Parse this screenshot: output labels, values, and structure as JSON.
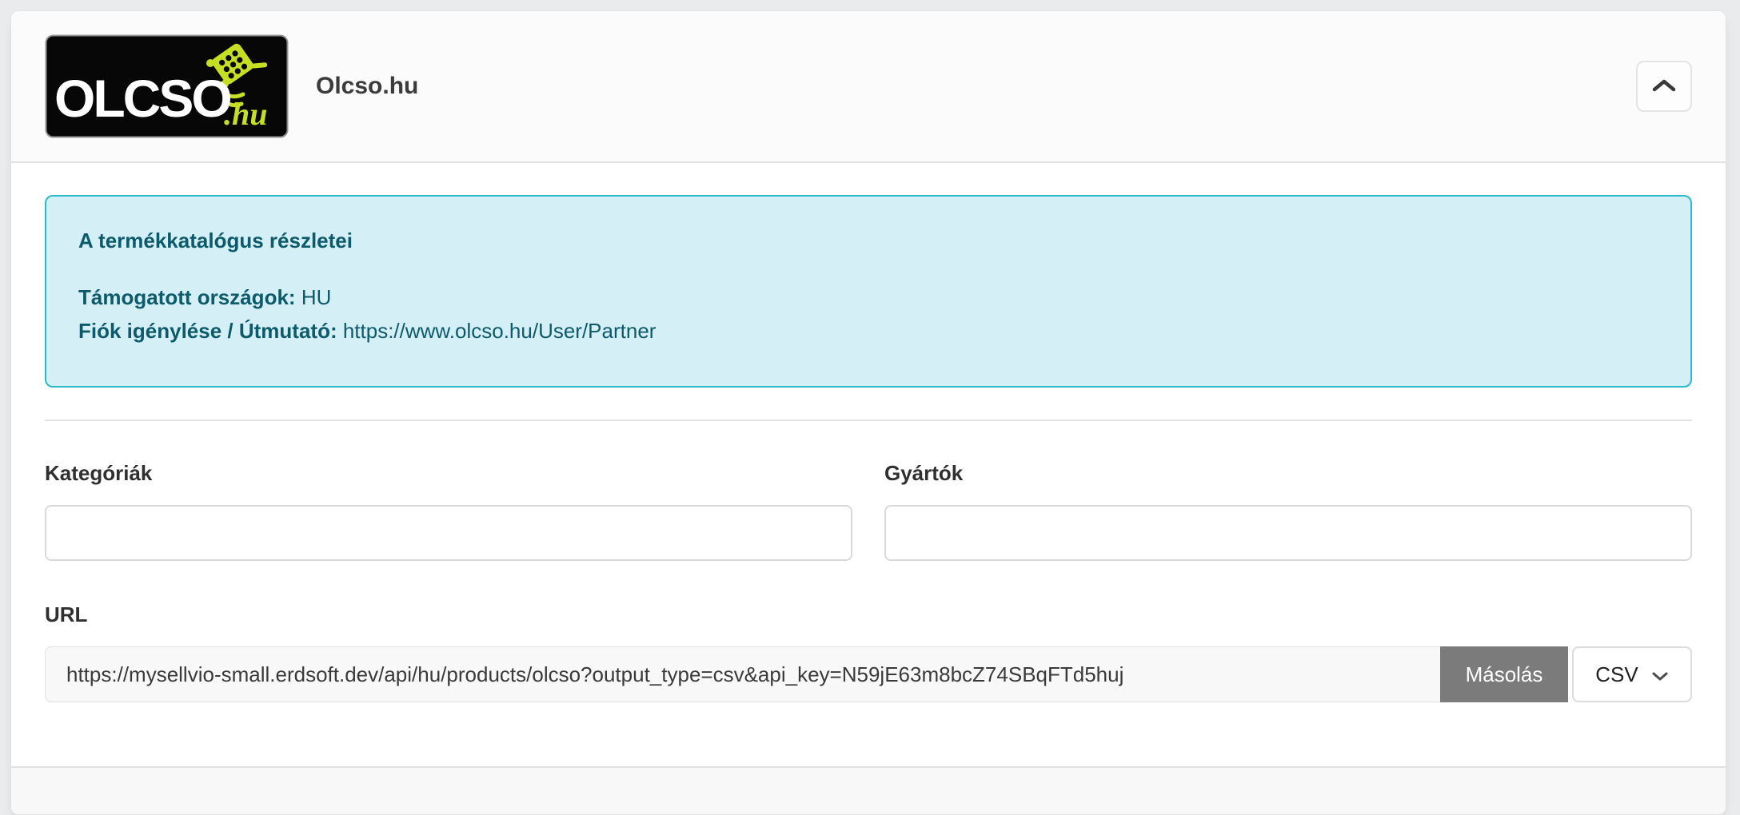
{
  "header": {
    "title": "Olcso.hu",
    "logo": {
      "word": "OLCSO",
      "tld": ".hu",
      "alt": "Olcso.hu logo"
    },
    "collapse_icon": "chevron-up"
  },
  "info_box": {
    "heading": "A termékkatalógus részletei",
    "supported_countries_label": "Támogatott országok:",
    "supported_countries_value": "HU",
    "account_label": "Fiók igénylése / Útmutató:",
    "account_value": "https://www.olcso.hu/User/Partner"
  },
  "form": {
    "categories_label": "Kategóriák",
    "categories_value": "",
    "manufacturers_label": "Gyártók",
    "manufacturers_value": "",
    "url_label": "URL",
    "url_value": "https://mysellvio-small.erdsoft.dev/api/hu/products/olcso?output_type=csv&api_key=N59jE63m8bcZ74SBqFTd5huj",
    "copy_button_label": "Másolás",
    "format_selected": "CSV"
  },
  "colors": {
    "page_bg": "#eaebed",
    "info_bg": "#d4f0f6",
    "info_border": "#2cb9ce",
    "info_text": "#0d5a6b",
    "copy_button_bg": "#7b7b7b",
    "logo_accent": "#c6df22",
    "logo_bg": "#070707"
  }
}
